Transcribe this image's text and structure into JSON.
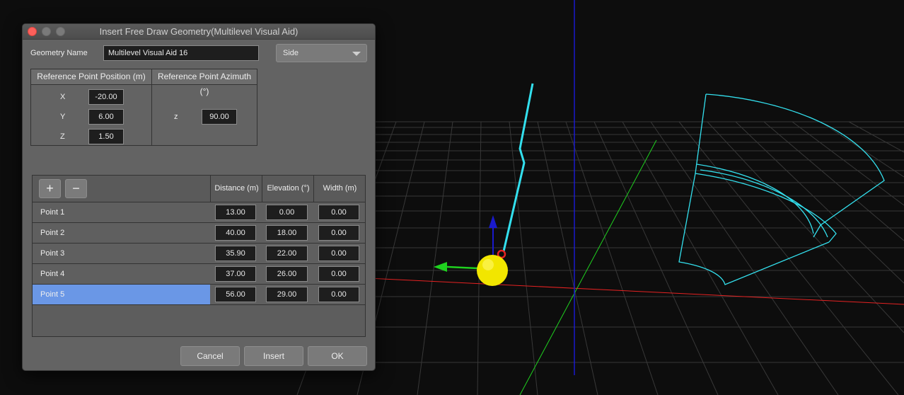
{
  "dialog": {
    "title": "Insert Free Draw Geometry(Multilevel Visual Aid)",
    "geometry_name_label": "Geometry Name",
    "geometry_name_value": "Multilevel Visual Aid 16",
    "view_select": "Side",
    "ref_position_header": "Reference Point Position (m)",
    "ref_azimuth_header": "Reference Point Azimuth (°)",
    "x_label": "X",
    "x_value": "-20.00",
    "y_label": "Y",
    "y_value": "6.00",
    "z_label": "Z",
    "z_value": "1.50",
    "az_label": "z",
    "az_value": "90.00",
    "add_label": "+",
    "remove_label": "−",
    "columns": [
      "Distance (m)",
      "Elevation (°)",
      "Width (m)"
    ],
    "points": [
      {
        "name": "Point 1",
        "distance": "13.00",
        "elevation": "0.00",
        "width": "0.00"
      },
      {
        "name": "Point 2",
        "distance": "40.00",
        "elevation": "18.00",
        "width": "0.00"
      },
      {
        "name": "Point 3",
        "distance": "35.90",
        "elevation": "22.00",
        "width": "0.00"
      },
      {
        "name": "Point 4",
        "distance": "37.00",
        "elevation": "26.00",
        "width": "0.00"
      },
      {
        "name": "Point 5",
        "distance": "56.00",
        "elevation": "29.00",
        "width": "0.00"
      }
    ],
    "cancel_label": "Cancel",
    "insert_label": "Insert",
    "ok_label": "OK"
  },
  "colors": {
    "selection": "#6a97e6",
    "grid": "#3a3a3a",
    "geometry": "#33e0ee",
    "x_axis": "#e52222",
    "y_axis": "#1fd11f",
    "z_axis": "#1a1acc",
    "gizmo_sphere": "#f2e600"
  }
}
